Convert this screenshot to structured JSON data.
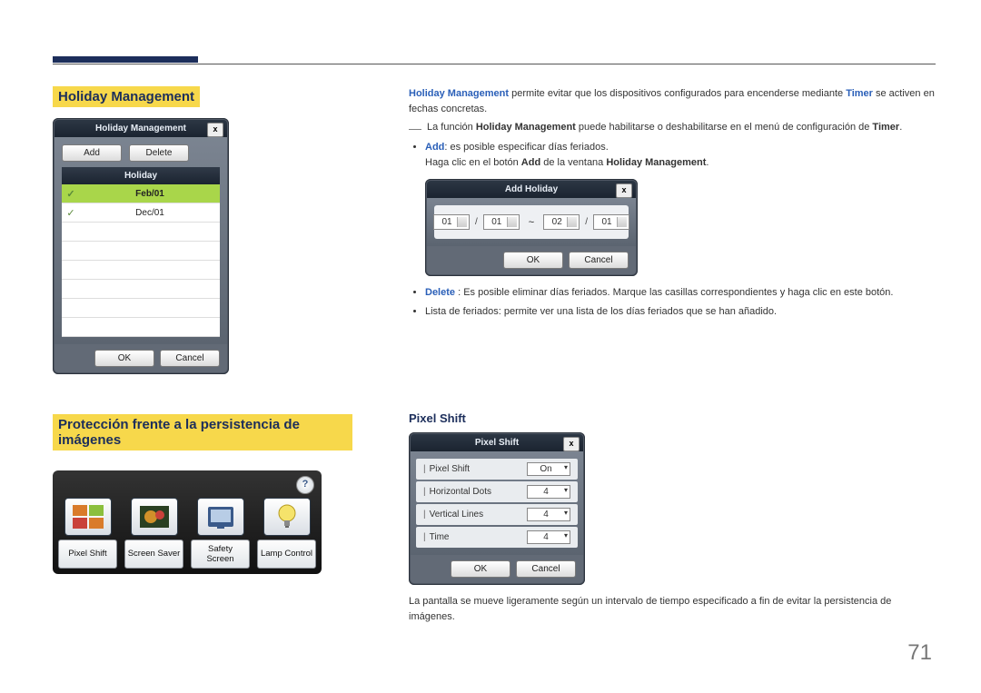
{
  "page_number": "71",
  "headings": {
    "h2_holiday": "Holiday Management",
    "h2_protection": "Protección frente a la persistencia de imágenes",
    "h3_pixel": "Pixel Shift"
  },
  "text": {
    "intro_pre": "Holiday Management",
    "intro_post": " permite evitar que los dispositivos configurados para encenderse mediante ",
    "intro_timer": "Timer",
    "intro_end": " se activen en fechas concretas.",
    "note_pre": "La función ",
    "note_hm": "Holiday Management",
    "note_mid": " puede habilitarse o deshabilitarse en el menú de configuración de ",
    "note_timer": "Timer",
    "note_end": ".",
    "add_label": "Add",
    "add_desc": ": es posible especificar días feriados.",
    "add_sub": "Haga clic en el botón ",
    "add_sub_btn": "Add",
    "add_sub_mid": " de la ventana ",
    "add_sub_win": "Holiday Management",
    "add_sub_end": ".",
    "delete_label": "Delete",
    "delete_desc": " : Es posible eliminar días feriados. Marque las casillas correspondientes y haga clic en este botón.",
    "list_desc": "Lista de feriados: permite ver una lista de los días feriados que se han añadido.",
    "pixel_desc": "La pantalla se mueve ligeramente según un intervalo de tiempo especificado a fin de evitar la persistencia de imágenes."
  },
  "hm_dialog": {
    "title": "Holiday Management",
    "add_btn": "Add",
    "delete_btn": "Delete",
    "col_header": "Holiday",
    "rows": [
      {
        "checked": true,
        "date": "Feb/01",
        "selected": true
      },
      {
        "checked": true,
        "date": "Dec/01",
        "selected": false
      }
    ],
    "ok": "OK",
    "cancel": "Cancel"
  },
  "add_holiday_dialog": {
    "title": "Add Holiday",
    "from_m": "01",
    "from_d": "01",
    "to_m": "02",
    "to_d": "01",
    "ok": "OK",
    "cancel": "Cancel"
  },
  "protection_strip": {
    "items": [
      {
        "label": "Pixel\nShift"
      },
      {
        "label": "Screen\nSaver"
      },
      {
        "label": "Safety\nScreen"
      },
      {
        "label": "Lamp\nControl"
      }
    ]
  },
  "pixel_dialog": {
    "title": "Pixel Shift",
    "rows": [
      {
        "label": "Pixel Shift",
        "value": "On"
      },
      {
        "label": "Horizontal Dots",
        "value": "4"
      },
      {
        "label": "Vertical Lines",
        "value": "4"
      },
      {
        "label": "Time",
        "value": "4"
      }
    ],
    "ok": "OK",
    "cancel": "Cancel"
  }
}
